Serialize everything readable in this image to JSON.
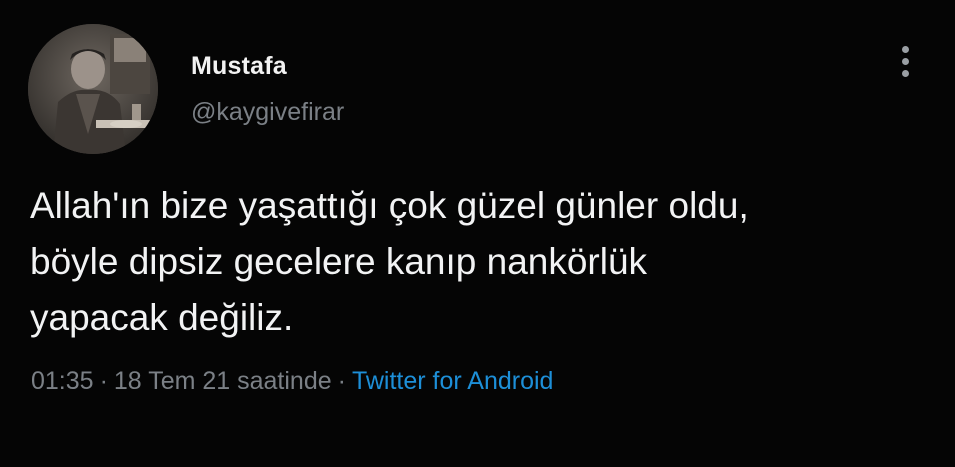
{
  "user": {
    "name": "Mustafa",
    "handle": "@kaygivefirar"
  },
  "tweet": {
    "lines": [
      "Allah'ın bize yaşattığı çok güzel günler oldu,",
      "böyle dipsiz gecelere kanıp nankörlük",
      "yapacak değiliz."
    ],
    "time": "01:35",
    "date": "18 Tem 21 saatinde",
    "separator": "·",
    "source": "Twitter for Android"
  },
  "icons": {
    "more": "more-vertical-icon",
    "avatar": "profile-photo"
  },
  "colors": {
    "background": "#000000",
    "text": "#f2f3f4",
    "muted": "#7b8086",
    "link": "#1d8fd8"
  }
}
